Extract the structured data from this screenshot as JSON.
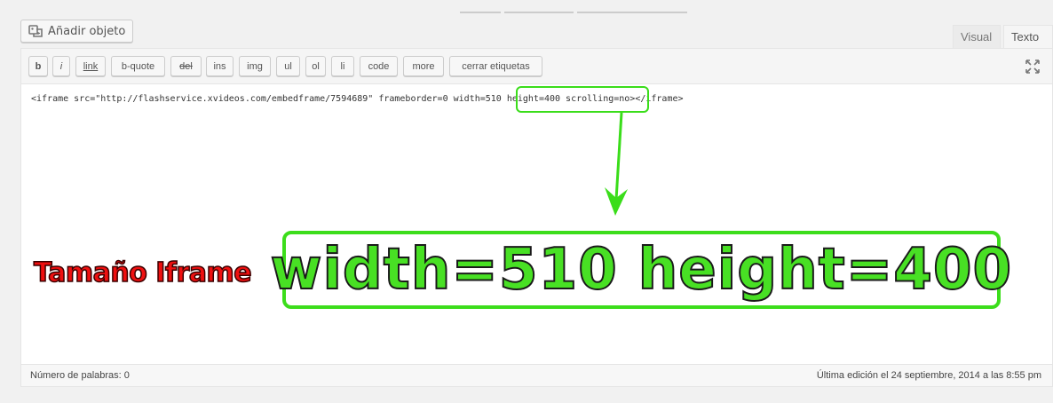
{
  "media": {
    "add_label": "Añadir objeto",
    "icon": "media-icon"
  },
  "tabs": {
    "visual": "Visual",
    "texto": "Texto"
  },
  "toolbar": {
    "buttons": [
      "b",
      "i",
      "link",
      "b-quote",
      "del",
      "ins",
      "img",
      "ul",
      "ol",
      "li",
      "code",
      "more",
      "cerrar etiquetas"
    ],
    "fullscreen_icon": "fullscreen-icon"
  },
  "editor": {
    "content": "<iframe src=\"http://flashservice.xvideos.com/embedframe/7594689\" frameborder=0 width=510 height=400 scrolling=no></iframe>"
  },
  "status": {
    "word_count": "Número de palabras: 0",
    "last_edit": "Última edición el 24 septiembre, 2014 a las 8:55 pm"
  },
  "annotation": {
    "label": "Tamaño Iframe",
    "big_text": "width=510 height=400",
    "accent": "#3cdd1b",
    "label_color": "#ef1010"
  }
}
